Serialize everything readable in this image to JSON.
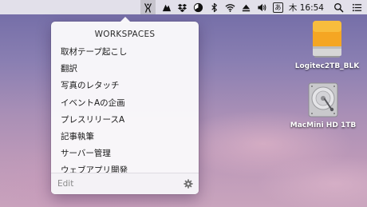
{
  "menubar": {
    "ime_label": "あ",
    "clock": "木 16:54"
  },
  "panel": {
    "title": "WORKSPACES",
    "items": [
      "取材テープ起こし",
      "翻訳",
      "写真のレタッチ",
      "イベントAの企画",
      "プレスリリースA",
      "記事執筆",
      "サーバー管理",
      "ウェブアプリ開発"
    ],
    "edit_label": "Edit"
  },
  "desktop": {
    "drives": [
      {
        "label": "Logitec2TB_BLK",
        "icon": "external-drive-icon"
      },
      {
        "label": "MacMini HD 1TB",
        "icon": "internal-hard-drive-icon"
      }
    ]
  },
  "colors": {
    "menubar_bg": "#ecebf0",
    "panel_bg": "#faf9fb",
    "drive_orange": "#f5a623"
  }
}
